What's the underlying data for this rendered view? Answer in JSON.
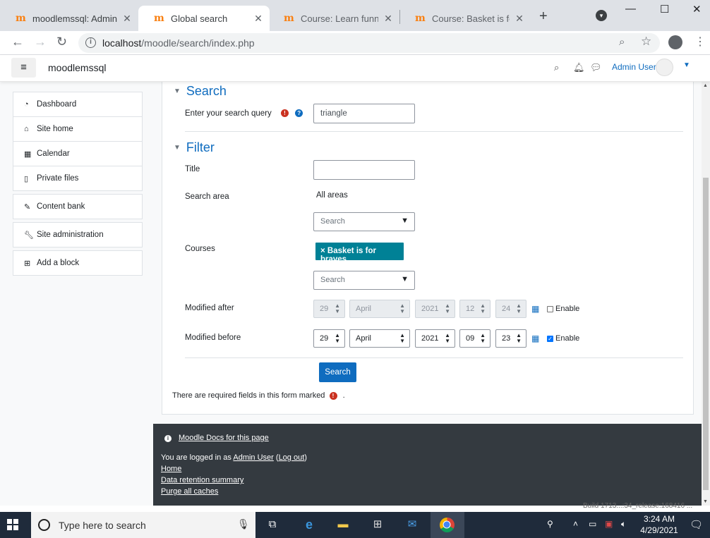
{
  "browser": {
    "tabs": [
      {
        "title": "moodlemssql: Adminis",
        "active": false
      },
      {
        "title": "Global search",
        "active": true
      },
      {
        "title": "Course: Learn funny m",
        "active": false
      },
      {
        "title": "Course: Basket is for br",
        "active": false
      }
    ],
    "favicon": "m",
    "url_host": "localhost",
    "url_path": "/moodle/search/index.php"
  },
  "navbar": {
    "site_name": "moodlemssql",
    "user_name": "Admin User"
  },
  "sidebar": {
    "items": [
      {
        "label": "Dashboard",
        "icon": "dashboard-icon"
      },
      {
        "label": "Site home",
        "icon": "home-icon"
      },
      {
        "label": "Calendar",
        "icon": "calendar-icon"
      },
      {
        "label": "Private files",
        "icon": "file-icon"
      },
      {
        "label": "Content bank",
        "icon": "brush-icon"
      },
      {
        "label": "Site administration",
        "icon": "wrench-icon"
      },
      {
        "label": "Add a block",
        "icon": "plus-square-icon"
      }
    ]
  },
  "form": {
    "search_section": "Search",
    "query_label": "Enter your search query",
    "query_value": "triangle",
    "filter_section": "Filter",
    "title_label": "Title",
    "title_value": "",
    "search_area_label": "Search area",
    "search_area_value": "All areas",
    "search_area_select": "Search",
    "courses_label": "Courses",
    "course_chip": "× Basket is for braves",
    "courses_select": "Search",
    "modified_after_label": "Modified after",
    "modified_after": {
      "day": "29",
      "month": "April",
      "year": "2021",
      "hour": "12",
      "minute": "24",
      "enabled": false
    },
    "modified_before_label": "Modified before",
    "modified_before": {
      "day": "29",
      "month": "April",
      "year": "2021",
      "hour": "09",
      "minute": "23",
      "enabled": true
    },
    "enable_label": "Enable",
    "submit_label": "Search",
    "required_note": "There are required fields in this form marked",
    "required_note_end": "."
  },
  "footer": {
    "docs_link": "Moodle Docs for this page",
    "logged_in_prefix": "You are logged in as",
    "user_link": "Admin User",
    "logout_link": "Log out",
    "links": [
      "Home",
      "Data retention summary",
      "Purge all caches"
    ]
  },
  "build_info": "Build 1713...:34_release:168416 ...",
  "taskbar": {
    "search_placeholder": "Type here to search",
    "time": "3:24 AM",
    "date": "4/29/2021"
  }
}
